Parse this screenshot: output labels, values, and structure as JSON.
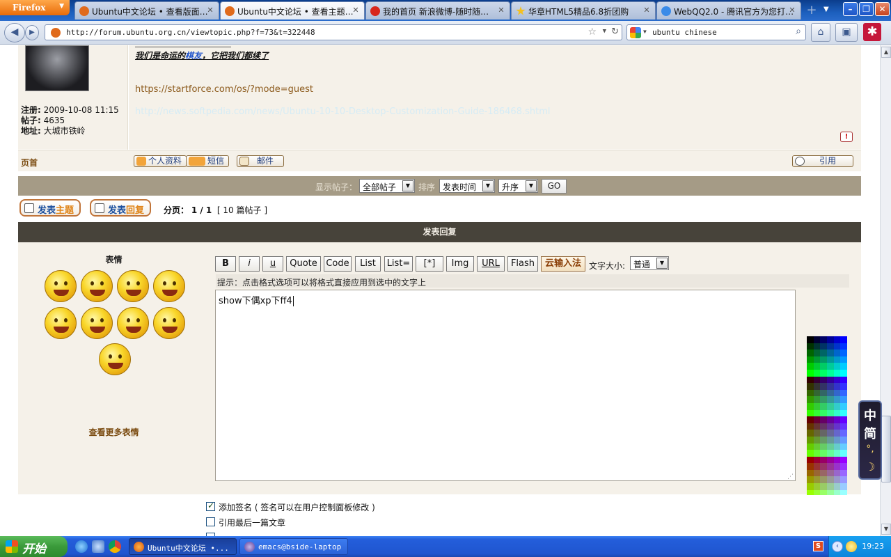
{
  "browser": {
    "menu_button": "Firefox",
    "tabs": [
      {
        "title": "Ubuntu中文论坛 • 查看版面…",
        "active": false
      },
      {
        "title": "Ubuntu中文论坛 • 查看主题…",
        "active": true
      },
      {
        "title": "我的首页 新浪微博-随时随…",
        "active": false
      },
      {
        "title": "华章HTML5精品6.8折团购",
        "active": false
      },
      {
        "title": "WebQQ2.0 - 腾讯官方为您打…",
        "active": false
      }
    ],
    "url": "http://forum.ubuntu.org.cn/viewtopic.php?f=73&t=322448",
    "search_value": "ubuntu chinese"
  },
  "post": {
    "signature_before": "我们是命运的",
    "signature_highlight": "棋友",
    "signature_after": "，它把我们都续了",
    "link1": "https://startforce.com/os/?mode=guest",
    "link2": "http://news.softpedia.com/news/Ubuntu-10-10-Desktop-Customization-Guide-186468.shtml",
    "meta": {
      "registered_label": "注册:",
      "registered_value": "2009-10-08 11:15",
      "posts_label": "帖子:",
      "posts_value": "4635",
      "location_label": "地址:",
      "location_value": "大城市铁岭"
    },
    "top_link": "页首",
    "buttons": {
      "profile": "个人资料",
      "pm": "短信",
      "email": "邮件",
      "quote": "引用"
    }
  },
  "filter": {
    "show_label": "显示帖子：",
    "show_value": "全部帖子",
    "sort_label": "排序",
    "sort_value": "发表时间",
    "order_value": "升序",
    "go": "GO"
  },
  "actions": {
    "new_topic_a": "发表",
    "new_topic_b": "主题",
    "reply_a": "发表",
    "reply_b": "回复",
    "pagination_label": "分页：",
    "pagination_value": "1 / 1",
    "post_count": "[ 10 篇帖子 ]"
  },
  "reply": {
    "heading": "发表回复",
    "emoticons_title": "表情",
    "more_emoticons": "查看更多表情",
    "toolbar": [
      "B",
      "i",
      "u",
      "Quote",
      "Code",
      "List",
      "List=",
      "[*]",
      "Img",
      "URL",
      "Flash"
    ],
    "cloud_ime": "云输入法",
    "font_size_label": "文字大小:",
    "font_size_value": "普通",
    "hint": "提示：点击格式选项可以将格式直接应用到选中的文字上",
    "message": "show下偶xp下ff4"
  },
  "options": {
    "attach_sig": "添加签名 ( 签名可以在用户控制面板修改 )",
    "attach_sig_checked": true,
    "quote_last": "引用最后一篇文章",
    "quote_last_checked": false
  },
  "ime": {
    "c1": "中",
    "c2": "简"
  },
  "taskbar": {
    "start": "开始",
    "items": [
      {
        "label": "Ubuntu中文论坛 •...",
        "active": true
      },
      {
        "label": "emacs@bside-laptop",
        "active": false
      }
    ],
    "clock": "19:23"
  },
  "colors": {
    "accent_brown": "#47433a",
    "panel": "#f5f1e9",
    "filterbar": "#a59b86"
  }
}
